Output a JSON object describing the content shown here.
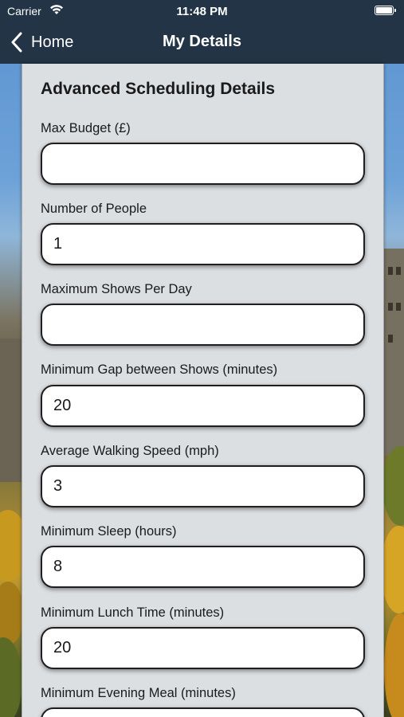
{
  "status_bar": {
    "carrier": "Carrier",
    "time": "11:48 PM",
    "icons": [
      "wifi-icon",
      "battery-icon"
    ]
  },
  "nav": {
    "back_label": "Home",
    "back_icon": "chevron-left-icon",
    "title": "My Details",
    "bar_color": "#223446"
  },
  "panel": {
    "section_title": "Advanced Scheduling Details",
    "fields": [
      {
        "label": "Max Budget (£)",
        "value": ""
      },
      {
        "label": "Number of People",
        "value": "1"
      },
      {
        "label": "Maximum Shows Per Day",
        "value": ""
      },
      {
        "label": "Minimum Gap between Shows (minutes)",
        "value": "20"
      },
      {
        "label": "Average Walking Speed (mph)",
        "value": "3"
      },
      {
        "label": "Minimum Sleep (hours)",
        "value": "8"
      },
      {
        "label": "Minimum Lunch Time (minutes)",
        "value": "20"
      },
      {
        "label": "Minimum Evening Meal (minutes)",
        "value": ""
      }
    ]
  }
}
